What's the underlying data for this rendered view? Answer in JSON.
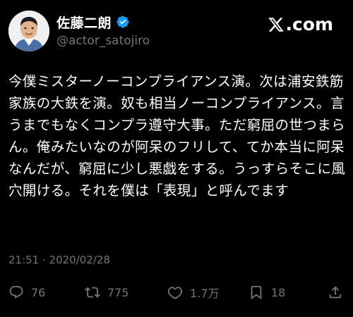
{
  "header": {
    "display_name": "佐藤二朗",
    "handle": "@actor_satojiro",
    "brand": ".com",
    "verified_icon": "verified-badge-icon",
    "brand_icon": "x-logo-icon"
  },
  "tweet": {
    "text": "今僕ミスターノーコンプライアンス演。次は浦安鉄筋家族の大鉄を演。奴も相当ノーコンプライアンス。言うまでもなくコンプラ遵守大事。ただ窮屈の世つまらん。俺みたいなのが阿呆のフリして、てか本当に阿呆なんだが、窮屈に少し悪戯をする。うっすらそこに風穴開ける。それを僕は「表現」と呼んでます",
    "timestamp": "21:51 · 2020/02/28"
  },
  "actions": {
    "reply_count": "76",
    "retweet_count": "775",
    "like_count": "1.7万",
    "bookmark_count": "18"
  },
  "colors": {
    "background": "#000000",
    "text": "#ffffff",
    "secondary": "#71767b",
    "verified": "#1d9bf0"
  }
}
